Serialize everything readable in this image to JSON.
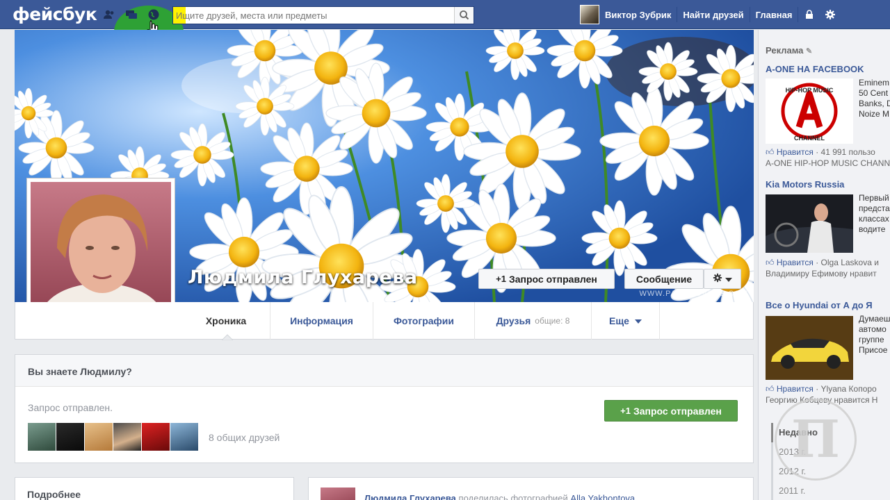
{
  "topbar": {
    "logo": "фейсбук",
    "search_placeholder": "Ищите друзей, места или предметы",
    "user_name": "Виктор Зубрик",
    "find_friends": "Найти друзей",
    "home": "Главная"
  },
  "profile": {
    "name": "Людмила Глухарева",
    "request_sent_button": "Запрос отправлен",
    "message_button": "Сообщение",
    "cover_watermark": "WWW.PAGECOVERS.COM"
  },
  "tabs": [
    {
      "label": "Хроника"
    },
    {
      "label": "Информация"
    },
    {
      "label": "Фотографии"
    },
    {
      "label": "Друзья",
      "sub": "общие: 8"
    },
    {
      "label": "Еще"
    }
  ],
  "know_box": {
    "title": "Вы знаете Людмилу?",
    "status": "Запрос отправлен.",
    "mutual_friends": "8 общих друзей",
    "button": "Запрос отправлен"
  },
  "more_card": {
    "title": "Подробнее"
  },
  "post": {
    "author": "Людмила Глухарева",
    "action": "поделилась фотографией",
    "target": "Alla Yakhontova"
  },
  "sidebar": {
    "ads_label": "Реклама",
    "ads": [
      {
        "title": "A-ONE НА FACEBOOK",
        "text": [
          "Eminem",
          "50 Cent",
          "Banks, D",
          "Noize M"
        ],
        "like": "Нравится",
        "like_count": "· 41 991 пользо",
        "like_line2": "A-ONE HIP-HOP MUSIC CHANN"
      },
      {
        "title": "Kia Motors Russia",
        "text": [
          "Первый",
          "предста",
          "классах",
          "водите"
        ],
        "like": "Нравится",
        "like_count": "· Olga Laskova и",
        "like_line2": "Владимиру Ефимову нравит"
      },
      {
        "title": "Все о Hyundai от А до Я",
        "text": [
          "Думаеш",
          "автомо",
          "группе",
          "Присое"
        ],
        "like": "Нравится",
        "like_count": "· Ylyana Копоро",
        "like_line2": "Георгию Кобцеву нравится Н"
      }
    ],
    "recent_label": "Недавно",
    "years": [
      "2013 г.",
      "2012 г.",
      "2011 г."
    ]
  },
  "watermark_letter": "П",
  "colors": {
    "brand": "#3b5998",
    "confirm_green": "#5aa14a",
    "cursor_highlight": "#2ea82a"
  }
}
